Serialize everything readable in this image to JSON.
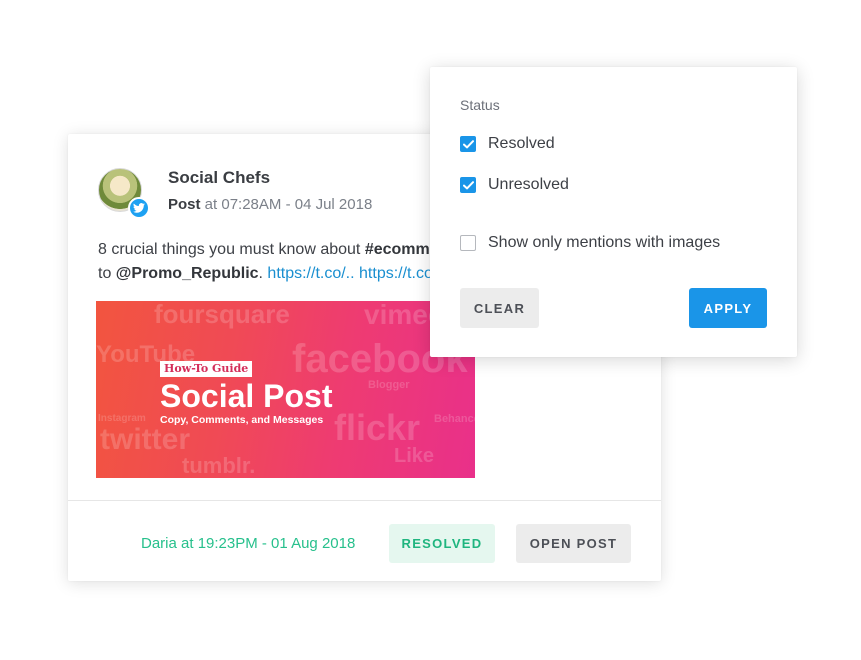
{
  "post": {
    "author": "Social Chefs",
    "kind": "Post",
    "meta": " at 07:28AM - 04 Jul 2018",
    "text_part1": "8 crucial things you must know about ",
    "hashtag": "#ecomm",
    "text_part2": "to ",
    "mention": "@Promo_Republic",
    "text_part3": ". ",
    "link1": "https://t.co/..",
    "link2": "https://t.co",
    "image": {
      "tag": "How-To Guide",
      "title": "Social Post",
      "subtitle": "Copy, Comments, and Messages",
      "background_words": [
        "foursquare",
        "YouTube",
        "facebook",
        "vimeo",
        "flickr",
        "Like",
        "tumblr.",
        "twitter",
        "Blogger",
        "Behance",
        "Instagram"
      ]
    },
    "resolver_note": "Daria at 19:23PM - 01 Aug 2018",
    "resolved_label": "RESOLVED",
    "open_post_label": "OPEN POST"
  },
  "filter": {
    "title": "Status",
    "options": [
      {
        "label": "Resolved",
        "checked": true
      },
      {
        "label": "Unresolved",
        "checked": true
      },
      {
        "label": "Show only mentions with images",
        "checked": false
      }
    ],
    "clear_label": "CLEAR",
    "apply_label": "APPLY"
  },
  "colors": {
    "accent_blue": "#1a95e8",
    "resolved_green": "#1fb57f",
    "twitter_blue": "#1da1f2"
  }
}
